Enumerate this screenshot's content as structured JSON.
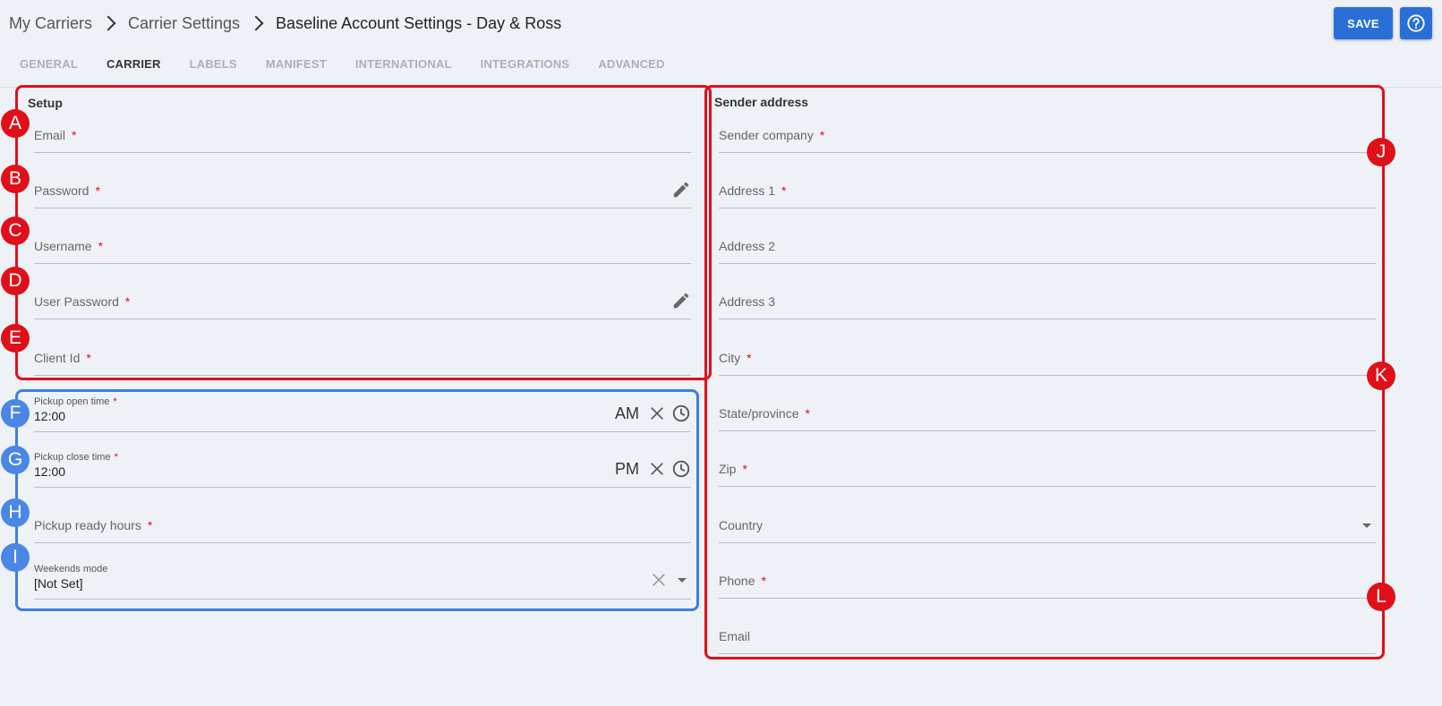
{
  "breadcrumb": {
    "item1": "My Carriers",
    "item2": "Carrier Settings",
    "current": "Baseline Account Settings - Day & Ross"
  },
  "toolbar": {
    "save_label": "SAVE"
  },
  "tabs": [
    {
      "label": "GENERAL"
    },
    {
      "label": "CARRIER"
    },
    {
      "label": "LABELS"
    },
    {
      "label": "MANIFEST"
    },
    {
      "label": "INTERNATIONAL"
    },
    {
      "label": "INTEGRATIONS"
    },
    {
      "label": "ADVANCED"
    }
  ],
  "setup": {
    "title": "Setup",
    "email": "Email",
    "password": "Password",
    "username": "Username",
    "user_password": "User Password",
    "client_id": "Client Id"
  },
  "pickup": {
    "open_label": "Pickup open time",
    "open_value": "12:00",
    "open_ampm": "AM",
    "close_label": "Pickup close time",
    "close_value": "12:00",
    "close_ampm": "PM",
    "ready_hours": "Pickup ready hours",
    "weekends_label": "Weekends mode",
    "weekends_value": "[Not Set]"
  },
  "sender": {
    "title": "Sender address",
    "company": "Sender company",
    "address1": "Address 1",
    "address2": "Address 2",
    "address3": "Address 3",
    "city": "City",
    "state": "State/province",
    "zip": "Zip",
    "country": "Country",
    "phone": "Phone",
    "email": "Email"
  },
  "required_mark": "*",
  "badges": {
    "a": "A",
    "b": "B",
    "c": "C",
    "d": "D",
    "e": "E",
    "f": "F",
    "g": "G",
    "h": "H",
    "i": "I",
    "j": "J",
    "k": "K",
    "l": "L"
  },
  "colors": {
    "accent": "#2a6fd6",
    "annotation_red": "#e0101a",
    "annotation_blue": "#3d7fe0",
    "background": "#eef1f6"
  }
}
